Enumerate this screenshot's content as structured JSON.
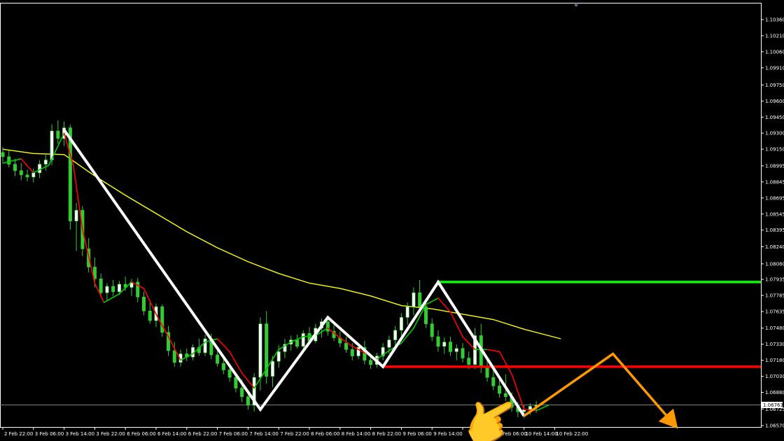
{
  "chart_data": {
    "type": "candlestick",
    "background": "#000000",
    "colors": {
      "bull_candle": "#ffffff",
      "bear_candle": "#32cd32",
      "wick": "#32cd32",
      "ma_slow": "#ffff00",
      "ma_fast_up": "#00cc00",
      "ma_fast_down": "#ff0000",
      "pattern_line": "#ffffff",
      "resistance_line": "#00ff00",
      "support_line": "#ff0000",
      "projection": "#ff9900",
      "axis": "#ffffff",
      "current_price_line": "#808080"
    },
    "y_ticks": [
      "1.10360",
      "1.10210",
      "1.10060",
      "1.09910",
      "1.09750",
      "1.09600",
      "1.09450",
      "1.09300",
      "1.09150",
      "1.08995",
      "1.08845",
      "1.08695",
      "1.08545",
      "1.08395",
      "1.08240",
      "1.08080",
      "1.07935",
      "1.07785",
      "1.07635",
      "1.07480",
      "1.07330",
      "1.07180",
      "1.07030",
      "1.06880",
      "1.06725",
      "1.06570"
    ],
    "ylim": [
      1.0657,
      1.1036
    ],
    "x_ticks": [
      "2 Feb 22:00",
      "3 Feb 06:00",
      "3 Feb 14:00",
      "3 Feb 22:00",
      "6 Feb 06:00",
      "6 Feb 14:00",
      "6 Feb 22:00",
      "7 Feb 06:00",
      "7 Feb 14:00",
      "7 Feb 22:00",
      "8 Feb 06:00",
      "8 Feb 14:00",
      "8 Feb 22:00",
      "9 Feb 06:00",
      "9 Feb 14:00",
      "",
      "10 Feb 06:00",
      "10 Feb 14:00",
      "10 Feb 22:00"
    ],
    "current_price": "1.06763",
    "current_price_value": 1.06763,
    "resistance_level": 1.0791,
    "support_level": 1.0712,
    "zigzag_points": [
      {
        "x": 2.0,
        "y": 1.0933
      },
      {
        "x": 8.4,
        "y": 1.0672
      },
      {
        "x": 10.6,
        "y": 1.0758
      },
      {
        "x": 12.4,
        "y": 1.0712
      },
      {
        "x": 14.2,
        "y": 1.0791
      },
      {
        "x": 17.0,
        "y": 1.0666
      }
    ],
    "projection_points": [
      {
        "x": 17.0,
        "y": 1.0666
      },
      {
        "x": 19.9,
        "y": 1.0724
      },
      {
        "x": 21.9,
        "y": 1.0658
      }
    ],
    "slow_ma": [
      {
        "x": 0.0,
        "y": 1.0915
      },
      {
        "x": 1.0,
        "y": 1.0911
      },
      {
        "x": 2.0,
        "y": 1.091
      },
      {
        "x": 3.0,
        "y": 1.089
      },
      {
        "x": 4.0,
        "y": 1.0872
      },
      {
        "x": 5.0,
        "y": 1.0855
      },
      {
        "x": 6.0,
        "y": 1.0838
      },
      {
        "x": 7.0,
        "y": 1.0823
      },
      {
        "x": 8.0,
        "y": 1.081
      },
      {
        "x": 9.0,
        "y": 1.0799
      },
      {
        "x": 10.0,
        "y": 1.079
      },
      {
        "x": 11.0,
        "y": 1.0785
      },
      {
        "x": 12.0,
        "y": 1.0778
      },
      {
        "x": 13.0,
        "y": 1.0769
      },
      {
        "x": 14.0,
        "y": 1.0766
      },
      {
        "x": 15.0,
        "y": 1.0761
      },
      {
        "x": 16.0,
        "y": 1.0756
      },
      {
        "x": 17.0,
        "y": 1.0747
      },
      {
        "x": 18.2,
        "y": 1.0738
      }
    ],
    "fast_ma": [
      {
        "x": 0.0,
        "y": 1.0902
      },
      {
        "x": 0.6,
        "y": 1.0906
      },
      {
        "x": 1.0,
        "y": 1.0893
      },
      {
        "x": 1.5,
        "y": 1.09
      },
      {
        "x": 2.0,
        "y": 1.093
      },
      {
        "x": 2.3,
        "y": 1.09
      },
      {
        "x": 2.6,
        "y": 1.084
      },
      {
        "x": 3.0,
        "y": 1.079
      },
      {
        "x": 3.3,
        "y": 1.0772
      },
      {
        "x": 3.8,
        "y": 1.078
      },
      {
        "x": 4.2,
        "y": 1.0791
      },
      {
        "x": 4.6,
        "y": 1.0785
      },
      {
        "x": 5.0,
        "y": 1.0761
      },
      {
        "x": 5.4,
        "y": 1.074
      },
      {
        "x": 5.8,
        "y": 1.0718
      },
      {
        "x": 6.2,
        "y": 1.0724
      },
      {
        "x": 6.6,
        "y": 1.0735
      },
      {
        "x": 7.0,
        "y": 1.0738
      },
      {
        "x": 7.4,
        "y": 1.0726
      },
      {
        "x": 7.8,
        "y": 1.0706
      },
      {
        "x": 8.2,
        "y": 1.0692
      },
      {
        "x": 8.6,
        "y": 1.071
      },
      {
        "x": 9.0,
        "y": 1.0728
      },
      {
        "x": 9.4,
        "y": 1.0735
      },
      {
        "x": 9.8,
        "y": 1.074
      },
      {
        "x": 10.2,
        "y": 1.0741
      },
      {
        "x": 10.6,
        "y": 1.0748
      },
      {
        "x": 11.0,
        "y": 1.0739
      },
      {
        "x": 11.4,
        "y": 1.0731
      },
      {
        "x": 11.8,
        "y": 1.0725
      },
      {
        "x": 12.2,
        "y": 1.0719
      },
      {
        "x": 12.6,
        "y": 1.0727
      },
      {
        "x": 13.0,
        "y": 1.0734
      },
      {
        "x": 13.4,
        "y": 1.0748
      },
      {
        "x": 13.8,
        "y": 1.077
      },
      {
        "x": 14.2,
        "y": 1.0776
      },
      {
        "x": 14.6,
        "y": 1.0763
      },
      {
        "x": 15.0,
        "y": 1.074
      },
      {
        "x": 15.4,
        "y": 1.0728
      },
      {
        "x": 15.8,
        "y": 1.0728
      },
      {
        "x": 16.2,
        "y": 1.0726
      },
      {
        "x": 16.6,
        "y": 1.0705
      },
      {
        "x": 17.0,
        "y": 1.0672
      },
      {
        "x": 17.4,
        "y": 1.0671
      },
      {
        "x": 17.8,
        "y": 1.0676
      }
    ],
    "candles": [
      {
        "x": 0.0,
        "o": 1.0912,
        "h": 1.0917,
        "l": 1.0903,
        "c": 1.0908
      },
      {
        "x": 0.2,
        "o": 1.0908,
        "h": 1.0914,
        "l": 1.0898,
        "c": 1.0901
      },
      {
        "x": 0.4,
        "o": 1.0901,
        "h": 1.0906,
        "l": 1.089,
        "c": 1.0895
      },
      {
        "x": 0.6,
        "o": 1.0895,
        "h": 1.0902,
        "l": 1.0886,
        "c": 1.0891
      },
      {
        "x": 0.8,
        "o": 1.0891,
        "h": 1.0896,
        "l": 1.0885,
        "c": 1.0889
      },
      {
        "x": 1.0,
        "o": 1.0889,
        "h": 1.0897,
        "l": 1.0884,
        "c": 1.0893
      },
      {
        "x": 1.2,
        "o": 1.0893,
        "h": 1.0905,
        "l": 1.0888,
        "c": 1.0901
      },
      {
        "x": 1.4,
        "o": 1.0901,
        "h": 1.091,
        "l": 1.0895,
        "c": 1.0905
      },
      {
        "x": 1.6,
        "o": 1.0905,
        "h": 1.0938,
        "l": 1.09,
        "c": 1.0932
      },
      {
        "x": 1.8,
        "o": 1.0932,
        "h": 1.0942,
        "l": 1.092,
        "c": 1.0925
      },
      {
        "x": 2.0,
        "o": 1.0925,
        "h": 1.0941,
        "l": 1.0918,
        "c": 1.0935
      },
      {
        "x": 2.2,
        "o": 1.0935,
        "h": 1.0938,
        "l": 1.084,
        "c": 1.0848
      },
      {
        "x": 2.4,
        "o": 1.0848,
        "h": 1.0865,
        "l": 1.082,
        "c": 1.0858
      },
      {
        "x": 2.6,
        "o": 1.0858,
        "h": 1.0862,
        "l": 1.0815,
        "c": 1.0822
      },
      {
        "x": 2.8,
        "o": 1.0822,
        "h": 1.0832,
        "l": 1.08,
        "c": 1.0805
      },
      {
        "x": 3.0,
        "o": 1.0805,
        "h": 1.0814,
        "l": 1.0786,
        "c": 1.0794
      },
      {
        "x": 3.2,
        "o": 1.0794,
        "h": 1.0799,
        "l": 1.0777,
        "c": 1.0781
      },
      {
        "x": 3.4,
        "o": 1.0781,
        "h": 1.079,
        "l": 1.0774,
        "c": 1.0787
      },
      {
        "x": 3.6,
        "o": 1.0787,
        "h": 1.0793,
        "l": 1.0778,
        "c": 1.0782
      },
      {
        "x": 3.8,
        "o": 1.0782,
        "h": 1.0792,
        "l": 1.0779,
        "c": 1.0789
      },
      {
        "x": 4.0,
        "o": 1.0789,
        "h": 1.0796,
        "l": 1.0783,
        "c": 1.0786
      },
      {
        "x": 4.2,
        "o": 1.0786,
        "h": 1.0794,
        "l": 1.0778,
        "c": 1.0791
      },
      {
        "x": 4.4,
        "o": 1.0791,
        "h": 1.0795,
        "l": 1.0772,
        "c": 1.0777
      },
      {
        "x": 4.6,
        "o": 1.0777,
        "h": 1.0782,
        "l": 1.076,
        "c": 1.0764
      },
      {
        "x": 4.8,
        "o": 1.0764,
        "h": 1.0772,
        "l": 1.0752,
        "c": 1.0755
      },
      {
        "x": 5.0,
        "o": 1.0755,
        "h": 1.0771,
        "l": 1.0749,
        "c": 1.0768
      },
      {
        "x": 5.2,
        "o": 1.0768,
        "h": 1.077,
        "l": 1.074,
        "c": 1.0744
      },
      {
        "x": 5.4,
        "o": 1.0744,
        "h": 1.075,
        "l": 1.0722,
        "c": 1.0727
      },
      {
        "x": 5.6,
        "o": 1.0727,
        "h": 1.0735,
        "l": 1.0712,
        "c": 1.0716
      },
      {
        "x": 5.8,
        "o": 1.0716,
        "h": 1.0728,
        "l": 1.0712,
        "c": 1.0724
      },
      {
        "x": 6.0,
        "o": 1.0724,
        "h": 1.0729,
        "l": 1.0717,
        "c": 1.0721
      },
      {
        "x": 6.2,
        "o": 1.0721,
        "h": 1.0733,
        "l": 1.0718,
        "c": 1.073
      },
      {
        "x": 6.4,
        "o": 1.073,
        "h": 1.0738,
        "l": 1.0722,
        "c": 1.0725
      },
      {
        "x": 6.6,
        "o": 1.0725,
        "h": 1.0742,
        "l": 1.0722,
        "c": 1.0738
      },
      {
        "x": 6.8,
        "o": 1.0738,
        "h": 1.0743,
        "l": 1.0719,
        "c": 1.0723
      },
      {
        "x": 7.0,
        "o": 1.0723,
        "h": 1.0729,
        "l": 1.0712,
        "c": 1.0715
      },
      {
        "x": 7.2,
        "o": 1.0715,
        "h": 1.0722,
        "l": 1.0705,
        "c": 1.0709
      },
      {
        "x": 7.4,
        "o": 1.0709,
        "h": 1.0714,
        "l": 1.0698,
        "c": 1.0702
      },
      {
        "x": 7.6,
        "o": 1.0702,
        "h": 1.0706,
        "l": 1.0688,
        "c": 1.0692
      },
      {
        "x": 7.8,
        "o": 1.0692,
        "h": 1.07,
        "l": 1.0679,
        "c": 1.0684
      },
      {
        "x": 8.0,
        "o": 1.0684,
        "h": 1.069,
        "l": 1.0672,
        "c": 1.0676
      },
      {
        "x": 8.2,
        "o": 1.0676,
        "h": 1.0706,
        "l": 1.067,
        "c": 1.0702
      },
      {
        "x": 8.4,
        "o": 1.0702,
        "h": 1.0758,
        "l": 1.069,
        "c": 1.0752
      },
      {
        "x": 8.6,
        "o": 1.0752,
        "h": 1.0764,
        "l": 1.0696,
        "c": 1.0703
      },
      {
        "x": 8.8,
        "o": 1.0703,
        "h": 1.0722,
        "l": 1.0693,
        "c": 1.0717
      },
      {
        "x": 9.0,
        "o": 1.0717,
        "h": 1.0732,
        "l": 1.0711,
        "c": 1.0726
      },
      {
        "x": 9.2,
        "o": 1.0726,
        "h": 1.0738,
        "l": 1.072,
        "c": 1.0733
      },
      {
        "x": 9.4,
        "o": 1.0733,
        "h": 1.0741,
        "l": 1.0727,
        "c": 1.0737
      },
      {
        "x": 9.6,
        "o": 1.0737,
        "h": 1.0742,
        "l": 1.0729,
        "c": 1.0731
      },
      {
        "x": 9.8,
        "o": 1.0731,
        "h": 1.0746,
        "l": 1.0728,
        "c": 1.0743
      },
      {
        "x": 10.0,
        "o": 1.0743,
        "h": 1.0749,
        "l": 1.0733,
        "c": 1.0736
      },
      {
        "x": 10.2,
        "o": 1.0736,
        "h": 1.0752,
        "l": 1.0734,
        "c": 1.0748
      },
      {
        "x": 10.4,
        "o": 1.0748,
        "h": 1.0757,
        "l": 1.0739,
        "c": 1.0754
      },
      {
        "x": 10.6,
        "o": 1.0754,
        "h": 1.0758,
        "l": 1.0741,
        "c": 1.0745
      },
      {
        "x": 10.8,
        "o": 1.0745,
        "h": 1.0751,
        "l": 1.0736,
        "c": 1.0739
      },
      {
        "x": 11.0,
        "o": 1.0739,
        "h": 1.0745,
        "l": 1.073,
        "c": 1.0734
      },
      {
        "x": 11.2,
        "o": 1.0734,
        "h": 1.074,
        "l": 1.0725,
        "c": 1.0728
      },
      {
        "x": 11.4,
        "o": 1.0728,
        "h": 1.0734,
        "l": 1.0718,
        "c": 1.0722
      },
      {
        "x": 11.6,
        "o": 1.0722,
        "h": 1.0733,
        "l": 1.0719,
        "c": 1.073
      },
      {
        "x": 11.8,
        "o": 1.073,
        "h": 1.0736,
        "l": 1.0714,
        "c": 1.0718
      },
      {
        "x": 12.0,
        "o": 1.0718,
        "h": 1.0724,
        "l": 1.071,
        "c": 1.0714
      },
      {
        "x": 12.2,
        "o": 1.0714,
        "h": 1.0725,
        "l": 1.0711,
        "c": 1.0722
      },
      {
        "x": 12.4,
        "o": 1.0722,
        "h": 1.0734,
        "l": 1.0718,
        "c": 1.073
      },
      {
        "x": 12.6,
        "o": 1.073,
        "h": 1.0741,
        "l": 1.0724,
        "c": 1.0737
      },
      {
        "x": 12.8,
        "o": 1.0737,
        "h": 1.075,
        "l": 1.0731,
        "c": 1.0746
      },
      {
        "x": 13.0,
        "o": 1.0746,
        "h": 1.0762,
        "l": 1.074,
        "c": 1.0758
      },
      {
        "x": 13.2,
        "o": 1.0758,
        "h": 1.0772,
        "l": 1.0751,
        "c": 1.0768
      },
      {
        "x": 13.4,
        "o": 1.0768,
        "h": 1.0786,
        "l": 1.076,
        "c": 1.0781
      },
      {
        "x": 13.6,
        "o": 1.0781,
        "h": 1.0793,
        "l": 1.0764,
        "c": 1.0768
      },
      {
        "x": 13.8,
        "o": 1.0768,
        "h": 1.0772,
        "l": 1.0748,
        "c": 1.0752
      },
      {
        "x": 14.0,
        "o": 1.0752,
        "h": 1.0757,
        "l": 1.0736,
        "c": 1.074
      },
      {
        "x": 14.2,
        "o": 1.074,
        "h": 1.0746,
        "l": 1.0726,
        "c": 1.0731
      },
      {
        "x": 14.4,
        "o": 1.0731,
        "h": 1.0739,
        "l": 1.0724,
        "c": 1.0735
      },
      {
        "x": 14.6,
        "o": 1.0735,
        "h": 1.074,
        "l": 1.0722,
        "c": 1.0726
      },
      {
        "x": 14.8,
        "o": 1.0726,
        "h": 1.0733,
        "l": 1.0718,
        "c": 1.0729
      },
      {
        "x": 15.0,
        "o": 1.0729,
        "h": 1.0734,
        "l": 1.0716,
        "c": 1.072
      },
      {
        "x": 15.2,
        "o": 1.072,
        "h": 1.0726,
        "l": 1.071,
        "c": 1.0714
      },
      {
        "x": 15.4,
        "o": 1.0714,
        "h": 1.0748,
        "l": 1.071,
        "c": 1.0741
      },
      {
        "x": 15.6,
        "o": 1.0741,
        "h": 1.0752,
        "l": 1.0706,
        "c": 1.0712
      },
      {
        "x": 15.8,
        "o": 1.0712,
        "h": 1.0718,
        "l": 1.0698,
        "c": 1.0702
      },
      {
        "x": 16.0,
        "o": 1.0702,
        "h": 1.0709,
        "l": 1.069,
        "c": 1.0694
      },
      {
        "x": 16.2,
        "o": 1.0694,
        "h": 1.07,
        "l": 1.0683,
        "c": 1.0687
      },
      {
        "x": 16.4,
        "o": 1.0687,
        "h": 1.0705,
        "l": 1.068,
        "c": 1.0684
      },
      {
        "x": 16.6,
        "o": 1.0684,
        "h": 1.0688,
        "l": 1.067,
        "c": 1.0674
      },
      {
        "x": 16.8,
        "o": 1.0674,
        "h": 1.0679,
        "l": 1.0665,
        "c": 1.067
      },
      {
        "x": 17.0,
        "o": 1.067,
        "h": 1.0676,
        "l": 1.0664,
        "c": 1.0672
      },
      {
        "x": 17.2,
        "o": 1.0672,
        "h": 1.0678,
        "l": 1.0667,
        "c": 1.0675
      },
      {
        "x": 17.4,
        "o": 1.0675,
        "h": 1.068,
        "l": 1.0669,
        "c": 1.0676
      }
    ]
  },
  "annotations": {
    "pointer": "👉",
    "pointer_icon": "hand-pointing-emoji"
  }
}
